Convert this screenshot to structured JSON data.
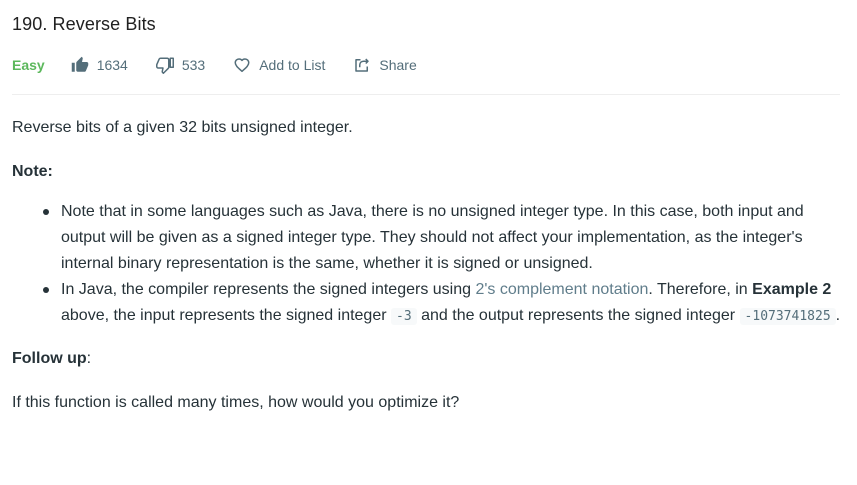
{
  "problem": {
    "title": "190. Reverse Bits",
    "difficulty": "Easy",
    "likes": "1634",
    "dislikes": "533",
    "add_to_list_label": "Add to List",
    "share_label": "Share"
  },
  "colors": {
    "difficulty_easy": "#5cb85c",
    "link": "#607d8b",
    "icon": "#546e7a"
  },
  "icons": [
    "thumbs-up-icon",
    "thumbs-down-icon",
    "heart-icon",
    "share-icon"
  ],
  "description": {
    "intro": "Reverse bits of a given 32 bits unsigned integer.",
    "note_heading": "Note:",
    "bullet1": "Note that in some languages such as Java, there is no unsigned integer type. In this case, both input and output will be given as a signed integer type. They should not affect your implementation, as the integer's internal binary representation is the same, whether it is signed or unsigned.",
    "bullet2_part1": "In Java, the compiler represents the signed integers using ",
    "bullet2_link": "2's complement notation",
    "bullet2_part2": ". Therefore, in ",
    "bullet2_bold": "Example 2",
    "bullet2_part3": " above, the input represents the signed integer ",
    "bullet2_code1": "-3",
    "bullet2_part4": " and the output represents the signed integer ",
    "bullet2_code2": "-1073741825",
    "bullet2_part5": ".",
    "follow_up_heading": "Follow up",
    "follow_up_colon": ":",
    "follow_up_text": "If this function is called many times, how would you optimize it?"
  }
}
